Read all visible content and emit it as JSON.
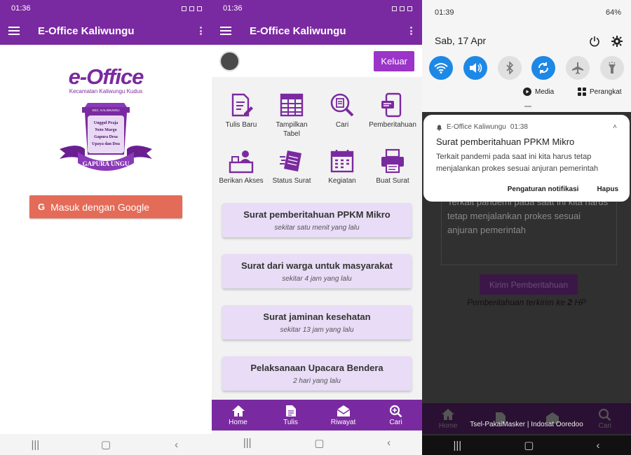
{
  "screen1": {
    "time": "01:36",
    "app_title": "E-Office Kaliwungu",
    "logo_title": "e-Office",
    "logo_subtitle": "Kecamatan Kaliwungu Kudus",
    "emblem_top": "KEC. KALIWUNGU",
    "emblem_lines": [
      "Unggul Praja",
      "Noto Margo",
      "Gapura Desa",
      "Upaya dan Doa"
    ],
    "emblem_ribbon": "GAPURA UNGU",
    "google_button": "Masuk dengan Google",
    "google_icon": "G"
  },
  "screen2": {
    "time": "01:36",
    "app_title": "E-Office Kaliwungu",
    "logout_button": "Keluar",
    "menu": [
      {
        "label": "Tulis Baru",
        "icon": "edit-document-icon"
      },
      {
        "label": "Tampilkan Tabel",
        "icon": "table-icon"
      },
      {
        "label": "Cari",
        "icon": "search-document-icon"
      },
      {
        "label": "Pemberitahuan",
        "icon": "phone-message-icon"
      },
      {
        "label": "Berikan Akses",
        "icon": "desk-user-icon"
      },
      {
        "label": "Status Surat",
        "icon": "sent-document-icon"
      },
      {
        "label": "Kegiatan",
        "icon": "calendar-icon"
      },
      {
        "label": "Buat Surat",
        "icon": "printer-icon"
      }
    ],
    "letters": [
      {
        "title": "Surat pemberitahuan PPKM Mikro",
        "time": "sekitar satu menit yang lalu"
      },
      {
        "title": "Surat dari warga untuk masyarakat",
        "time": "sekitar 4 jam yang lalu"
      },
      {
        "title": "Surat jaminan kesehatan",
        "time": "sekitar 13 jam yang lalu"
      },
      {
        "title": "Pelaksanaan Upacara Bendera",
        "time": "2 hari yang lalu"
      }
    ],
    "bottom_nav": [
      "Home",
      "Tulis",
      "Riwayat",
      "Cari"
    ]
  },
  "screen3": {
    "time": "01:39",
    "battery": "64%",
    "date": "Sab, 17 Apr",
    "media_label": "Media",
    "devices_label": "Perangkat",
    "notif_app": "E-Office Kaliwungu",
    "notif_time": "01:38",
    "notif_title": "Surat pemberitahuan PPKM Mikro",
    "notif_body": "Terkait pandemi pada saat ini kita harus tetap menjalankan prokes sesuai anjuran pemerintah",
    "notif_settings": "Pengaturan notifikasi",
    "notif_delete": "Hapus",
    "behind_text": "Terkait pandemi pada saat ini kita harus tetap menjalankan prokes sesuai anjuran pemerintah",
    "send_button": "Kirim Pemberitahuan",
    "sent_prefix": "Pemberitahuan terkirim ke ",
    "sent_count": "2",
    "sent_suffix": " HP",
    "carrier": "Tsel-PakaiMasker | Indosat Ooredoo",
    "bottom_nav": [
      "Home",
      "Cari"
    ]
  },
  "colors": {
    "primary": "#7a2aa0",
    "card": "#e8dcf7",
    "google": "#e46b58",
    "tile_on": "#1e88e5"
  }
}
